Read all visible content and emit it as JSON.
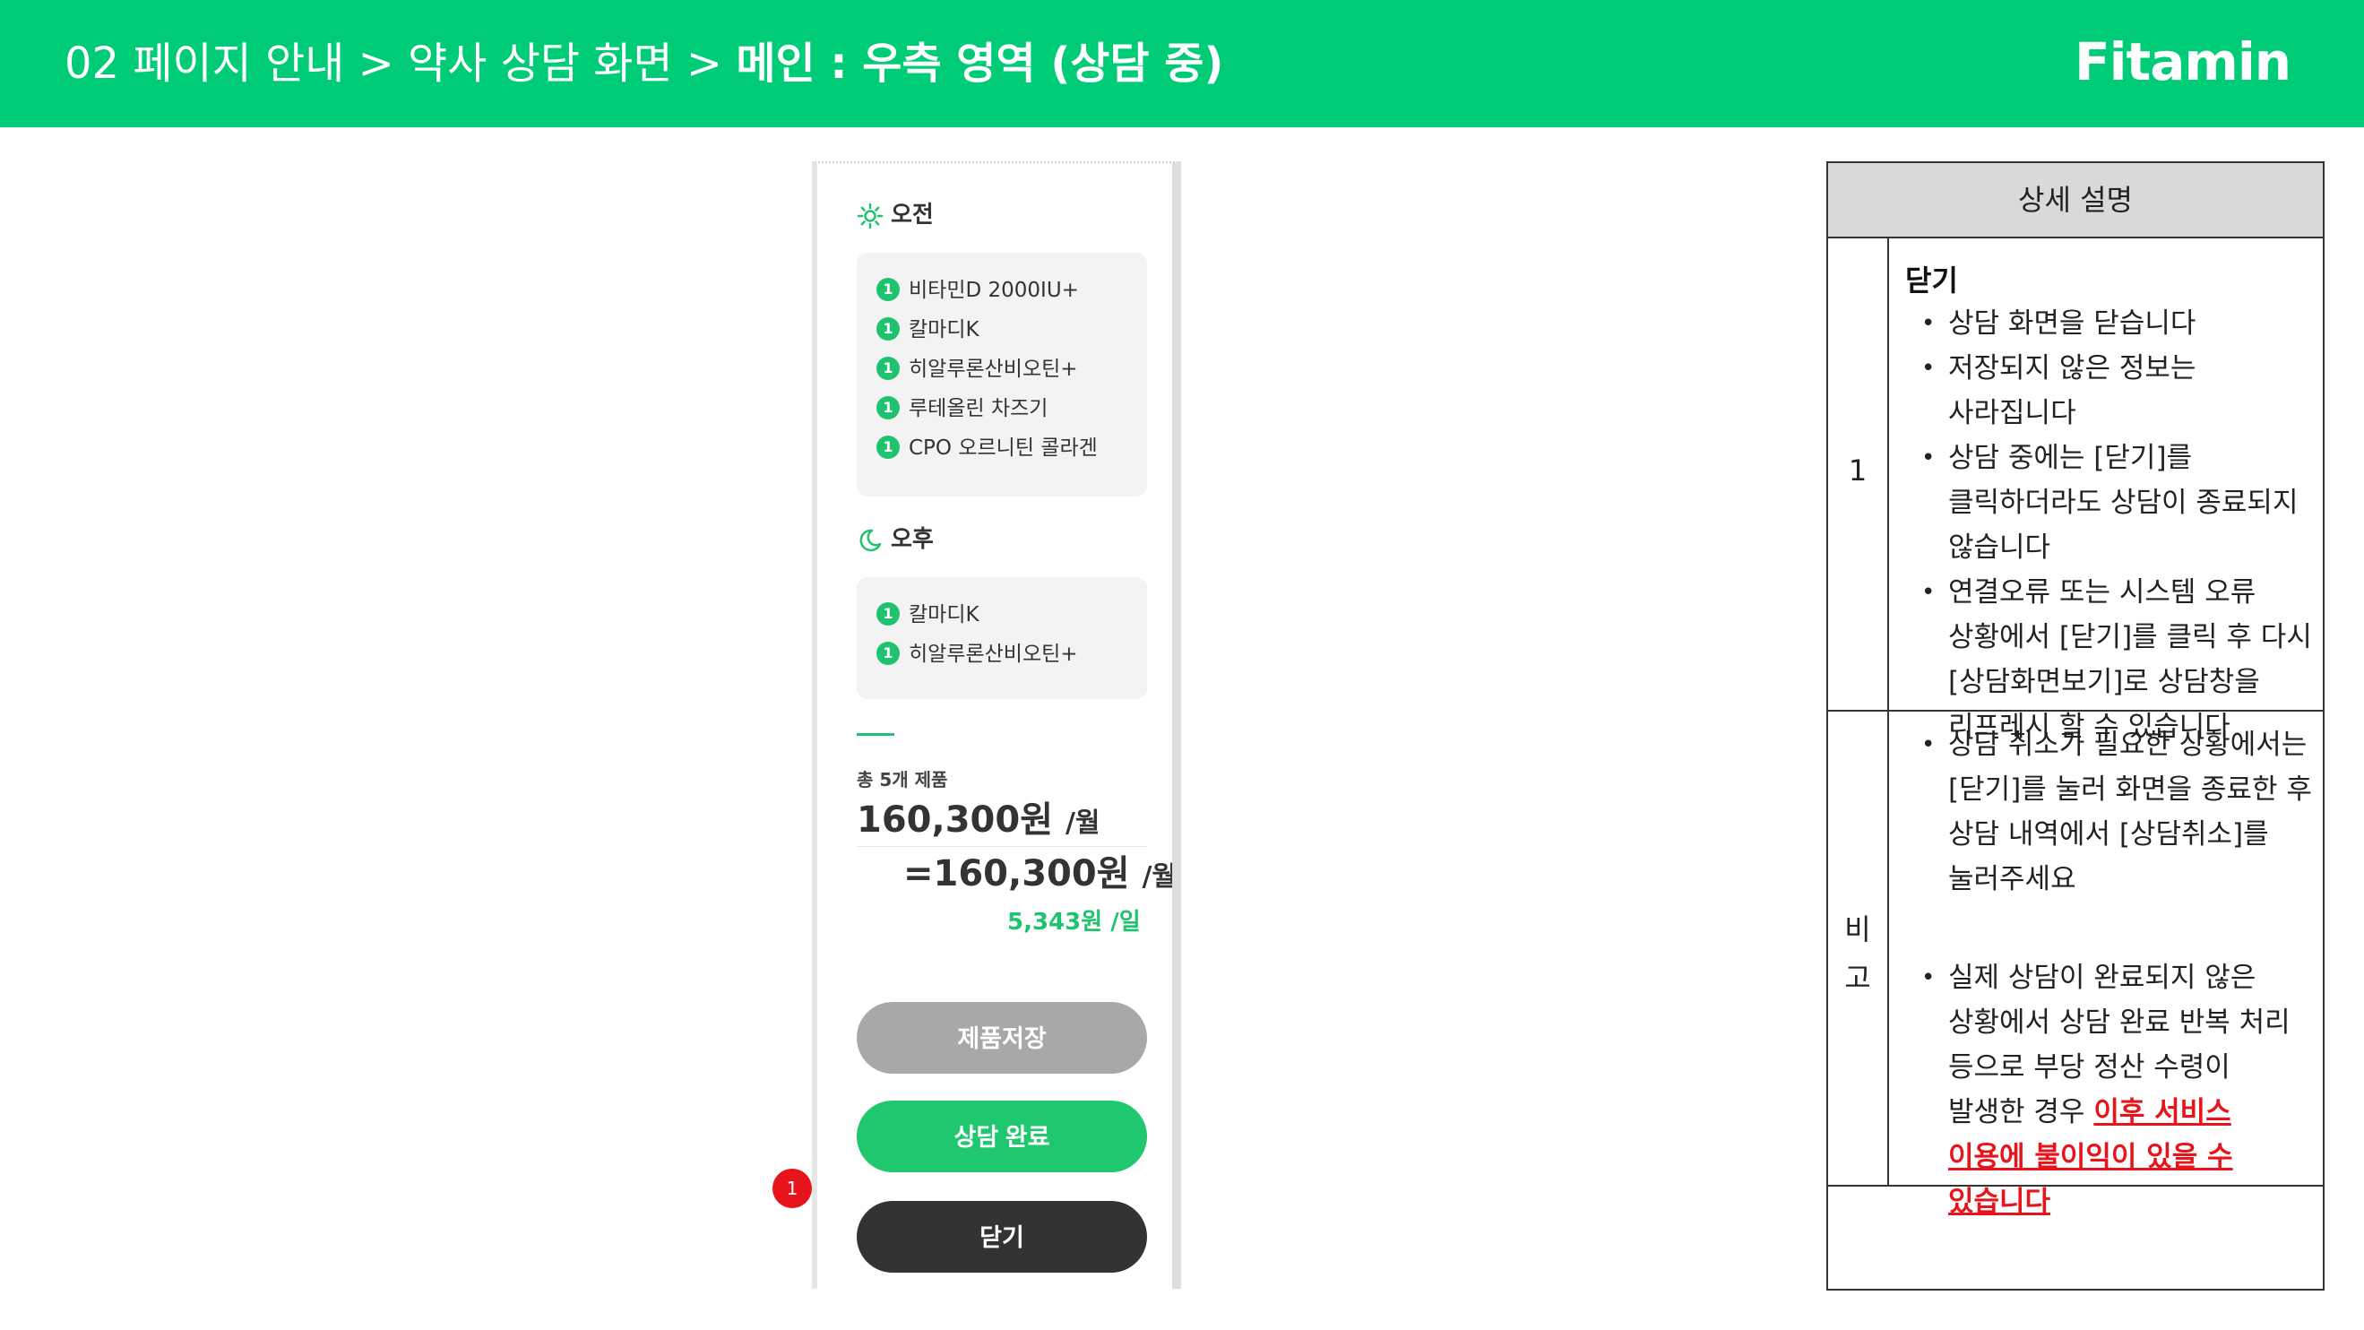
{
  "header": {
    "breadcrumb_prefix": "02 페이지 안내 > 약사 상담 화면 > ",
    "breadcrumb_current": "메인 : 우측 영역 (상담 중)",
    "logo": "Fitamin"
  },
  "panel": {
    "morning": {
      "title": "오전",
      "icon": "sun-icon",
      "items": [
        {
          "count": "1",
          "name": "비타민D 2000IU+"
        },
        {
          "count": "1",
          "name": "칼마디K"
        },
        {
          "count": "1",
          "name": "히알루론산비오틴+"
        },
        {
          "count": "1",
          "name": "루테올린 차즈기"
        },
        {
          "count": "1",
          "name": "CPO 오르니틴 콜라겐"
        }
      ]
    },
    "afternoon": {
      "title": "오후",
      "icon": "moon-icon",
      "items": [
        {
          "count": "1",
          "name": "칼마디K"
        },
        {
          "count": "1",
          "name": "히알루론산비오틴+"
        }
      ]
    },
    "summary": {
      "total_label": "총 5개 제품",
      "monthly_price": "160,300원",
      "monthly_unit": "/월",
      "eq_price": "=160,300원",
      "eq_unit": "/월",
      "daily_price": "5,343원 /일"
    },
    "buttons": {
      "save": "제품저장",
      "complete": "상담 완료",
      "close": "닫기"
    },
    "marker": "1"
  },
  "description": {
    "header": "상세 설명",
    "row1": {
      "label": "1",
      "title": "닫기",
      "bullets": [
        "상담 화면을 닫습니다",
        "저장되지 않은 정보는 사라집니다",
        "상담 중에는 [닫기]를 클릭하더라도 상담이 종료되지 않습니다",
        "연결오류 또는 시스템 오류 상황에서 [닫기]를 클릭 후 다시 [상담화면보기]로 상담창을 리프레시 할 수 있습니다"
      ]
    },
    "row2": {
      "label_top": "비",
      "label_bottom": "고",
      "bullet1": "상담 취소가 필요한 상황에서는 [닫기]를 눌러 화면을 종료한 후 상담 내역에서 [상담취소]를 눌러주세요",
      "bullet2_plain": "실제 상담이 완료되지 않은 상황에서 상담 완료 반복 처리 등으로 부당 정산 수령이 발생한 경우 ",
      "bullet2_warn": "이후 서비스 이용에 불이익이 있을 수 있습니다"
    }
  },
  "colors": {
    "brand_green": "#00cc77",
    "button_green": "#1fc86f",
    "warning_red": "#e8141b"
  }
}
